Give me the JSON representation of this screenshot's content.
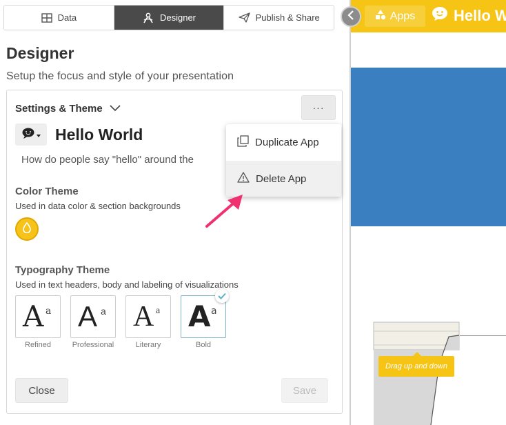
{
  "tabs": [
    {
      "label": "Data",
      "icon": "table-icon",
      "active": false
    },
    {
      "label": "Designer",
      "icon": "designer-tools-icon",
      "active": true
    },
    {
      "label": "Publish & Share",
      "icon": "paper-plane-icon",
      "active": false
    }
  ],
  "designer": {
    "title": "Designer",
    "subtitle": "Setup the focus and style of your presentation"
  },
  "settings": {
    "header": "Settings & Theme",
    "more_label": "···",
    "app_name": "Hello World",
    "app_description": "How do people say \"hello\" around the"
  },
  "color_theme": {
    "title": "Color Theme",
    "subtitle": "Used in data color & section backgrounds",
    "swatch_color": "#f6c31a"
  },
  "typography_theme": {
    "title": "Typography Theme",
    "subtitle": "Used in text headers, body and labeling of visualizations",
    "options": [
      {
        "label": "Refined",
        "big": "A",
        "small": "a",
        "selected": false
      },
      {
        "label": "Professional",
        "big": "A",
        "small": "a",
        "selected": false
      },
      {
        "label": "Literary",
        "big": "A",
        "small": "a",
        "selected": false
      },
      {
        "label": "Bold",
        "big": "A",
        "small": "a",
        "selected": true
      }
    ]
  },
  "buttons": {
    "close": "Close",
    "save": "Save"
  },
  "menu": {
    "items": [
      {
        "label": "Duplicate App",
        "icon": "duplicate-icon"
      },
      {
        "label": "Delete App",
        "icon": "warning-icon"
      }
    ]
  },
  "preview": {
    "apps_label": "Apps",
    "app_title": "Hello W",
    "tooltip": "Drag up and down"
  },
  "colors": {
    "brand_yellow": "#f5c415",
    "preview_blue": "#3a80c0",
    "active_tab": "#4a4a4a",
    "arrow_pink": "#f0306f"
  }
}
